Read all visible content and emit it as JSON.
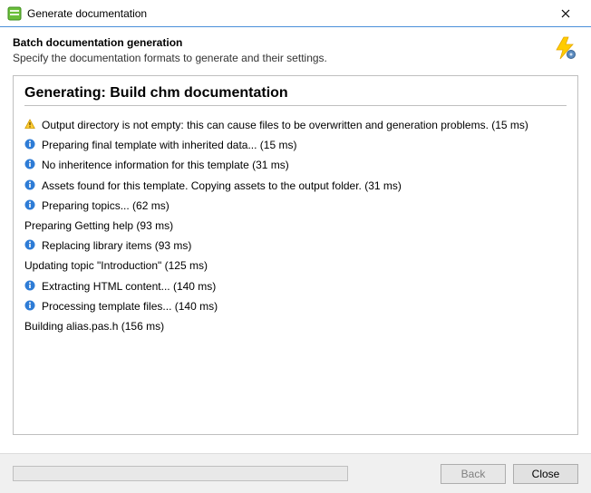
{
  "window": {
    "title": "Generate documentation"
  },
  "header": {
    "title": "Batch documentation generation",
    "description": "Specify the documentation formats to generate and their settings."
  },
  "section": {
    "heading": "Generating: Build chm documentation"
  },
  "log": [
    {
      "icon": "warning",
      "text": "Output directory is not empty: this can cause files to be overwritten and generation problems. (15 ms)"
    },
    {
      "icon": "info",
      "text": "Preparing final template with inherited data... (15 ms)"
    },
    {
      "icon": "info",
      "text": "No inheritence information for this template (31 ms)"
    },
    {
      "icon": "info",
      "text": "Assets found for this template. Copying assets to the output folder. (31 ms)"
    },
    {
      "icon": "info",
      "text": "Preparing topics... (62 ms)"
    },
    {
      "icon": "none",
      "text": "Preparing Getting help (93 ms)"
    },
    {
      "icon": "info",
      "text": "Replacing library items (93 ms)"
    },
    {
      "icon": "none",
      "text": "Updating topic \"Introduction\" (125 ms)"
    },
    {
      "icon": "info",
      "text": "Extracting HTML content... (140 ms)"
    },
    {
      "icon": "info",
      "text": "Processing template files... (140 ms)"
    },
    {
      "icon": "none",
      "text": "Building alias.pas.h (156 ms)"
    }
  ],
  "buttons": {
    "back": "Back",
    "close": "Close"
  }
}
